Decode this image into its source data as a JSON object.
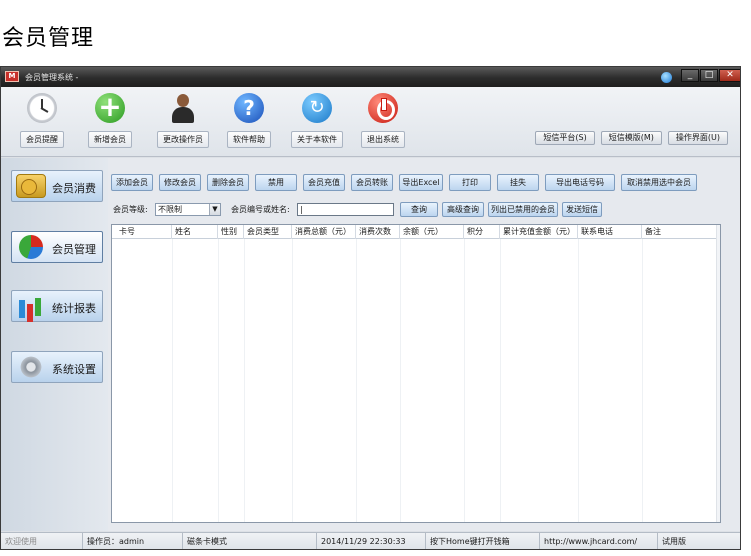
{
  "page_heading": "会员管理",
  "window": {
    "title": "会员管理系统 -",
    "app_icon_text": "M",
    "buttons": {
      "minimize": "_",
      "maximize": "□",
      "close": "✕"
    }
  },
  "toolbar": {
    "items": [
      {
        "label": "会员提醒",
        "icon": "clock-icon"
      },
      {
        "label": "新增会员",
        "icon": "plus-icon"
      },
      {
        "label": "更改操作员",
        "icon": "person-icon"
      },
      {
        "label": "软件帮助",
        "icon": "help-icon"
      },
      {
        "label": "关于本软件",
        "icon": "refresh-icon"
      },
      {
        "label": "退出系统",
        "icon": "power-icon"
      }
    ],
    "right_buttons": [
      "短信平台(S)",
      "短信模版(M)",
      "操作界面(U)"
    ]
  },
  "sidebar": {
    "items": [
      {
        "label": "会员消费",
        "icon": "money-icon"
      },
      {
        "label": "会员管理",
        "icon": "pie-chart-icon",
        "active": true
      },
      {
        "label": "统计报表",
        "icon": "bar-chart-icon"
      },
      {
        "label": "系统设置",
        "icon": "gear-icon"
      }
    ]
  },
  "actions": [
    "添加会员",
    "修改会员",
    "删除会员",
    "禁用",
    "会员充值",
    "会员转账",
    "导出Excel",
    "打印",
    "挂失",
    "导出电话号码",
    "取消禁用选中会员"
  ],
  "filter": {
    "level_label": "会员等级:",
    "level_value": "不限制",
    "search_label": "会员编号或姓名:",
    "search_value": "|",
    "buttons": [
      "查询",
      "高级查询",
      "列出已禁用的会员",
      "发送短信"
    ]
  },
  "table": {
    "columns": [
      "卡号",
      "姓名",
      "性别",
      "会员类型",
      "消费总额（元）",
      "消费次数",
      "余额（元）",
      "积分",
      "累计充值金额（元）",
      "联系电话",
      "备注"
    ],
    "rows": []
  },
  "statusbar": {
    "welcome": "欢迎使用",
    "operator": "操作员：admin",
    "mode": "磁条卡模式",
    "datetime": "2014/11/29 22:30:33",
    "hint": "按下Home键打开钱箱",
    "url": "http://www.jhcard.com/",
    "edition": "试用版"
  }
}
